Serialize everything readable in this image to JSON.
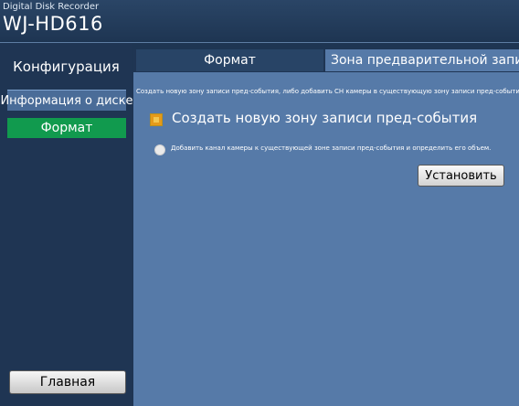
{
  "header": {
    "product_line": "Digital Disk Recorder",
    "model": "WJ-HD616"
  },
  "sidebar": {
    "title": "Конфигурация",
    "items": [
      {
        "label": "Информация о диске"
      },
      {
        "label": "Формат"
      }
    ],
    "home_label": "Главная"
  },
  "main": {
    "tabs": [
      {
        "label": "Формат"
      },
      {
        "label": "Зона предварительной записи"
      }
    ],
    "description": "Создать новую зону записи пред-события, либо добавить CH камеры в существующую зону записи пред-события.",
    "options": [
      {
        "label": "Создать новую зону записи пред-события"
      },
      {
        "label": "Добавить канал камеры к существующей зоне записи пред-события и определить его объем."
      }
    ],
    "set_label": "Установить"
  },
  "colors": {
    "background": "#1e3552",
    "content_panel": "#567aa8",
    "selected_item": "#119a4e",
    "highlight_item": "#4a6c98"
  }
}
